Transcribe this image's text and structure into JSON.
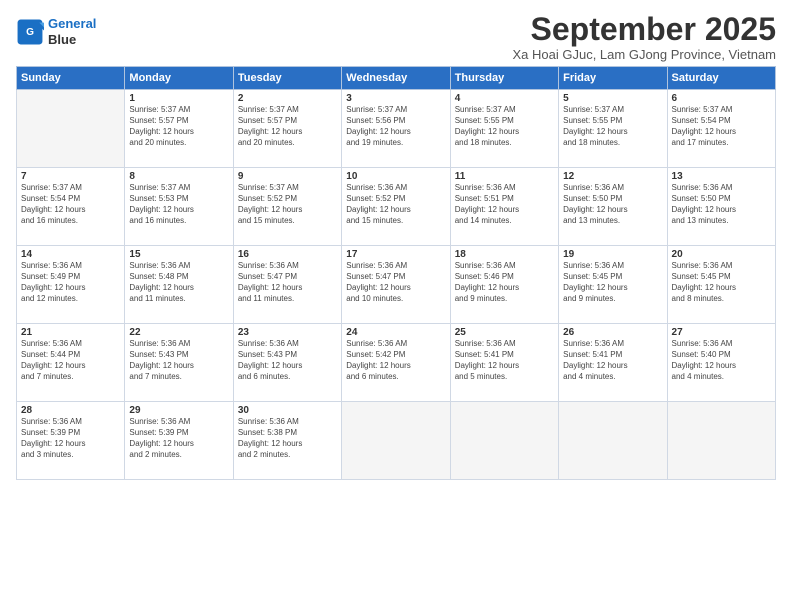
{
  "logo": {
    "line1": "General",
    "line2": "Blue"
  },
  "title": "September 2025",
  "subtitle": "Xa Hoai GJuc, Lam GJong Province, Vietnam",
  "days_header": [
    "Sunday",
    "Monday",
    "Tuesday",
    "Wednesday",
    "Thursday",
    "Friday",
    "Saturday"
  ],
  "weeks": [
    [
      {
        "day": "",
        "info": ""
      },
      {
        "day": "1",
        "info": "Sunrise: 5:37 AM\nSunset: 5:57 PM\nDaylight: 12 hours\nand 20 minutes."
      },
      {
        "day": "2",
        "info": "Sunrise: 5:37 AM\nSunset: 5:57 PM\nDaylight: 12 hours\nand 20 minutes."
      },
      {
        "day": "3",
        "info": "Sunrise: 5:37 AM\nSunset: 5:56 PM\nDaylight: 12 hours\nand 19 minutes."
      },
      {
        "day": "4",
        "info": "Sunrise: 5:37 AM\nSunset: 5:55 PM\nDaylight: 12 hours\nand 18 minutes."
      },
      {
        "day": "5",
        "info": "Sunrise: 5:37 AM\nSunset: 5:55 PM\nDaylight: 12 hours\nand 18 minutes."
      },
      {
        "day": "6",
        "info": "Sunrise: 5:37 AM\nSunset: 5:54 PM\nDaylight: 12 hours\nand 17 minutes."
      }
    ],
    [
      {
        "day": "7",
        "info": "Sunrise: 5:37 AM\nSunset: 5:54 PM\nDaylight: 12 hours\nand 16 minutes."
      },
      {
        "day": "8",
        "info": "Sunrise: 5:37 AM\nSunset: 5:53 PM\nDaylight: 12 hours\nand 16 minutes."
      },
      {
        "day": "9",
        "info": "Sunrise: 5:37 AM\nSunset: 5:52 PM\nDaylight: 12 hours\nand 15 minutes."
      },
      {
        "day": "10",
        "info": "Sunrise: 5:36 AM\nSunset: 5:52 PM\nDaylight: 12 hours\nand 15 minutes."
      },
      {
        "day": "11",
        "info": "Sunrise: 5:36 AM\nSunset: 5:51 PM\nDaylight: 12 hours\nand 14 minutes."
      },
      {
        "day": "12",
        "info": "Sunrise: 5:36 AM\nSunset: 5:50 PM\nDaylight: 12 hours\nand 13 minutes."
      },
      {
        "day": "13",
        "info": "Sunrise: 5:36 AM\nSunset: 5:50 PM\nDaylight: 12 hours\nand 13 minutes."
      }
    ],
    [
      {
        "day": "14",
        "info": "Sunrise: 5:36 AM\nSunset: 5:49 PM\nDaylight: 12 hours\nand 12 minutes."
      },
      {
        "day": "15",
        "info": "Sunrise: 5:36 AM\nSunset: 5:48 PM\nDaylight: 12 hours\nand 11 minutes."
      },
      {
        "day": "16",
        "info": "Sunrise: 5:36 AM\nSunset: 5:47 PM\nDaylight: 12 hours\nand 11 minutes."
      },
      {
        "day": "17",
        "info": "Sunrise: 5:36 AM\nSunset: 5:47 PM\nDaylight: 12 hours\nand 10 minutes."
      },
      {
        "day": "18",
        "info": "Sunrise: 5:36 AM\nSunset: 5:46 PM\nDaylight: 12 hours\nand 9 minutes."
      },
      {
        "day": "19",
        "info": "Sunrise: 5:36 AM\nSunset: 5:45 PM\nDaylight: 12 hours\nand 9 minutes."
      },
      {
        "day": "20",
        "info": "Sunrise: 5:36 AM\nSunset: 5:45 PM\nDaylight: 12 hours\nand 8 minutes."
      }
    ],
    [
      {
        "day": "21",
        "info": "Sunrise: 5:36 AM\nSunset: 5:44 PM\nDaylight: 12 hours\nand 7 minutes."
      },
      {
        "day": "22",
        "info": "Sunrise: 5:36 AM\nSunset: 5:43 PM\nDaylight: 12 hours\nand 7 minutes."
      },
      {
        "day": "23",
        "info": "Sunrise: 5:36 AM\nSunset: 5:43 PM\nDaylight: 12 hours\nand 6 minutes."
      },
      {
        "day": "24",
        "info": "Sunrise: 5:36 AM\nSunset: 5:42 PM\nDaylight: 12 hours\nand 6 minutes."
      },
      {
        "day": "25",
        "info": "Sunrise: 5:36 AM\nSunset: 5:41 PM\nDaylight: 12 hours\nand 5 minutes."
      },
      {
        "day": "26",
        "info": "Sunrise: 5:36 AM\nSunset: 5:41 PM\nDaylight: 12 hours\nand 4 minutes."
      },
      {
        "day": "27",
        "info": "Sunrise: 5:36 AM\nSunset: 5:40 PM\nDaylight: 12 hours\nand 4 minutes."
      }
    ],
    [
      {
        "day": "28",
        "info": "Sunrise: 5:36 AM\nSunset: 5:39 PM\nDaylight: 12 hours\nand 3 minutes."
      },
      {
        "day": "29",
        "info": "Sunrise: 5:36 AM\nSunset: 5:39 PM\nDaylight: 12 hours\nand 2 minutes."
      },
      {
        "day": "30",
        "info": "Sunrise: 5:36 AM\nSunset: 5:38 PM\nDaylight: 12 hours\nand 2 minutes."
      },
      {
        "day": "",
        "info": ""
      },
      {
        "day": "",
        "info": ""
      },
      {
        "day": "",
        "info": ""
      },
      {
        "day": "",
        "info": ""
      }
    ]
  ]
}
